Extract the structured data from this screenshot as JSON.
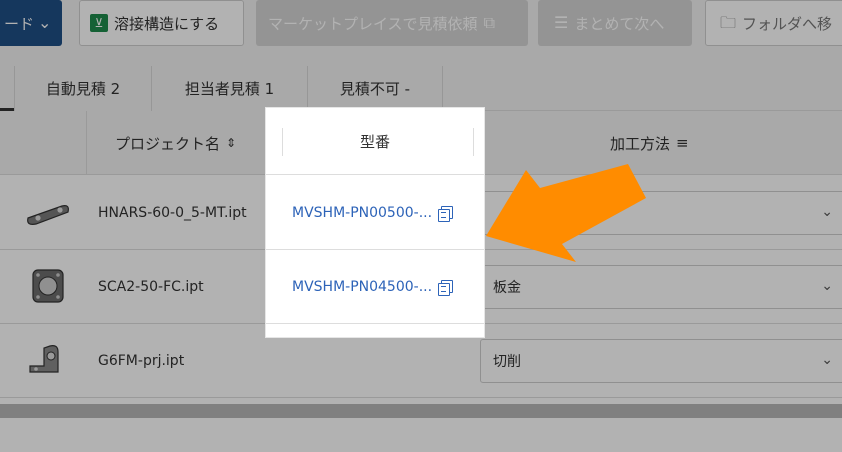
{
  "colors": {
    "accent": "#1f4f86",
    "link": "#2d63b8",
    "arrow": "#ff8c00",
    "weld_green": "#1f8c4d"
  },
  "toolbar": {
    "mode_label": "ード",
    "weld_label": "溶接構造にする",
    "marketplace_label": "マーケットプレイスで見積依頼",
    "batch_next_label": "まとめて次へ",
    "folder_label": "フォルダへ移"
  },
  "tabs": [
    {
      "label": "自動見積 2"
    },
    {
      "label": "担当者見積 1"
    },
    {
      "label": "見積不可 -"
    }
  ],
  "table": {
    "headers": {
      "project_name": "プロジェクト名",
      "model_number": "型番",
      "process_method": "加工方法"
    },
    "rows": [
      {
        "file": "HNARS-60-0_5-MT.ipt",
        "model": "MVSHM-PN00500-...",
        "method": "",
        "thumb_icon": "bracket-plate-icon"
      },
      {
        "file": "SCA2-50-FC.ipt",
        "model": "MVSHM-PN04500-...",
        "method": "板金",
        "thumb_icon": "square-flange-icon"
      },
      {
        "file": "G6FM-prj.ipt",
        "model": "",
        "method": "切削",
        "thumb_icon": "angle-bracket-icon"
      }
    ]
  }
}
